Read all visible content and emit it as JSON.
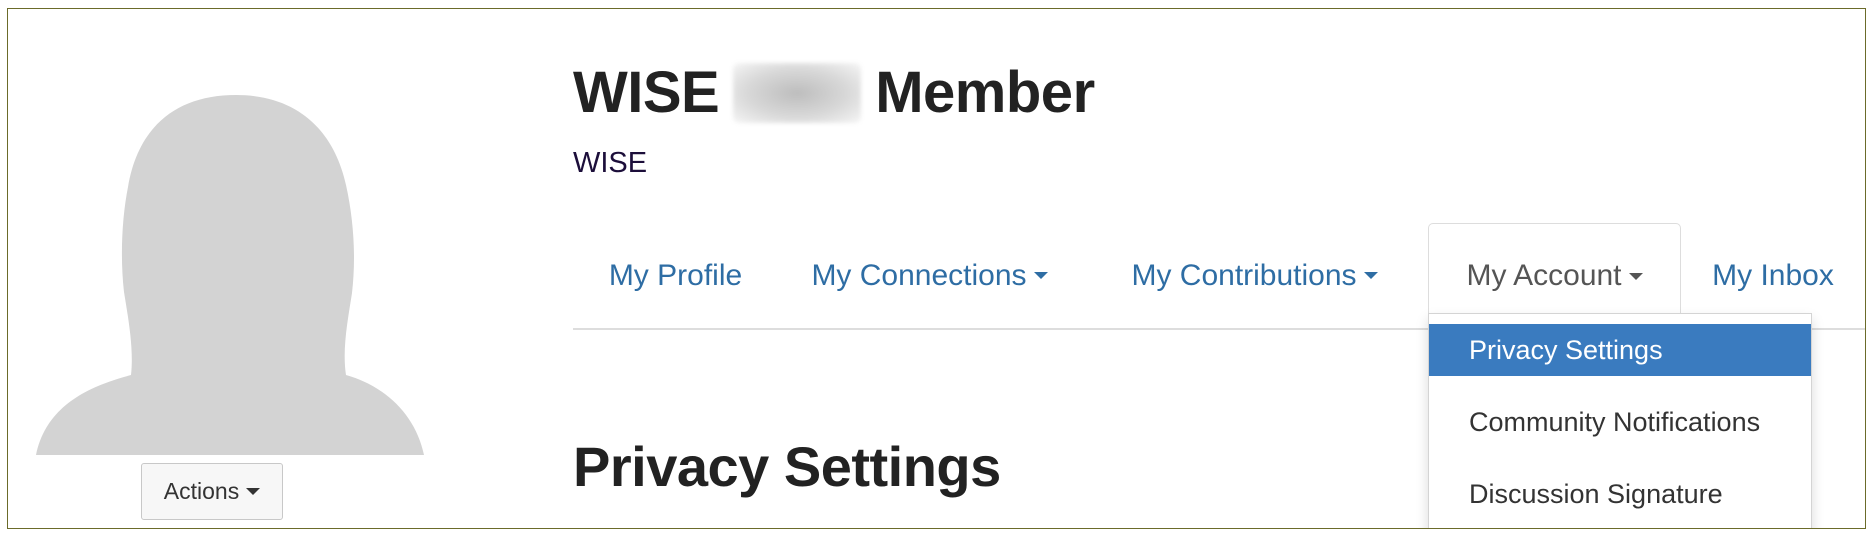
{
  "profile": {
    "name_first": "WISE",
    "name_last": "Member",
    "organization": "WISE",
    "actions_label": "Actions"
  },
  "tabs": [
    {
      "label": "My Profile",
      "dropdown": false
    },
    {
      "label": "My Connections",
      "dropdown": true
    },
    {
      "label": "My Contributions",
      "dropdown": true
    },
    {
      "label": "My Account",
      "dropdown": true,
      "active": true
    },
    {
      "label": "My Inbox",
      "dropdown": false
    }
  ],
  "account_menu": {
    "items": [
      {
        "label": "Privacy Settings",
        "selected": true
      },
      {
        "label": "Community Notifications"
      },
      {
        "label": "Discussion Signature"
      }
    ]
  },
  "main": {
    "heading": "Privacy Settings"
  },
  "colors": {
    "link": "#2e6da4",
    "menu_highlight": "#3a7bbf",
    "avatar_silhouette": "#d3d3d3",
    "frame_border": "#6b6b2a"
  },
  "icons": {
    "caret": "caret-down-icon",
    "avatar": "person-silhouette"
  }
}
